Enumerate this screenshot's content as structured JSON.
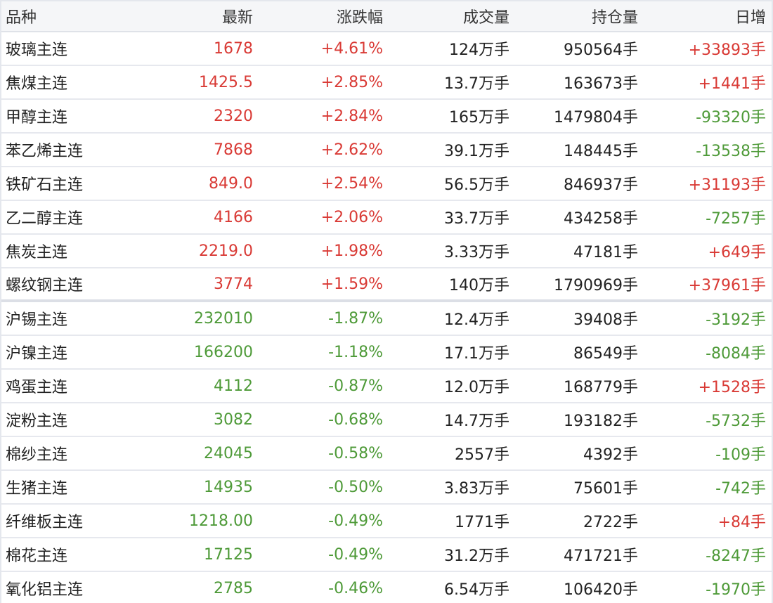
{
  "columns": {
    "name": "品种",
    "price": "最新",
    "change": "涨跌幅",
    "volume": "成交量",
    "open_interest": "持仓量",
    "daily_change": "日增"
  },
  "colors": {
    "up": "#d93a35",
    "down": "#4e9a38"
  },
  "rows": [
    {
      "name": "玻璃主连",
      "price": "1678",
      "change": "+4.61%",
      "volume": "124万手",
      "open_interest": "950564手",
      "daily_change": "+33893手",
      "trend": "up",
      "daily_trend": "up"
    },
    {
      "name": "焦煤主连",
      "price": "1425.5",
      "change": "+2.85%",
      "volume": "13.7万手",
      "open_interest": "163673手",
      "daily_change": "+1441手",
      "trend": "up",
      "daily_trend": "up"
    },
    {
      "name": "甲醇主连",
      "price": "2320",
      "change": "+2.84%",
      "volume": "165万手",
      "open_interest": "1479804手",
      "daily_change": "-93320手",
      "trend": "up",
      "daily_trend": "down"
    },
    {
      "name": "苯乙烯主连",
      "price": "7868",
      "change": "+2.62%",
      "volume": "39.1万手",
      "open_interest": "148445手",
      "daily_change": "-13538手",
      "trend": "up",
      "daily_trend": "down"
    },
    {
      "name": "铁矿石主连",
      "price": "849.0",
      "change": "+2.54%",
      "volume": "56.5万手",
      "open_interest": "846937手",
      "daily_change": "+31193手",
      "trend": "up",
      "daily_trend": "up"
    },
    {
      "name": "乙二醇主连",
      "price": "4166",
      "change": "+2.06%",
      "volume": "33.7万手",
      "open_interest": "434258手",
      "daily_change": "-7257手",
      "trend": "up",
      "daily_trend": "down"
    },
    {
      "name": "焦炭主连",
      "price": "2219.0",
      "change": "+1.98%",
      "volume": "3.33万手",
      "open_interest": "47181手",
      "daily_change": "+649手",
      "trend": "up",
      "daily_trend": "up"
    },
    {
      "name": "螺纹钢主连",
      "price": "3774",
      "change": "+1.59%",
      "volume": "140万手",
      "open_interest": "1790969手",
      "daily_change": "+37961手",
      "trend": "up",
      "daily_trend": "up"
    },
    {
      "name": "沪锡主连",
      "price": "232010",
      "change": "-1.87%",
      "volume": "12.4万手",
      "open_interest": "39408手",
      "daily_change": "-3192手",
      "trend": "down",
      "daily_trend": "down"
    },
    {
      "name": "沪镍主连",
      "price": "166200",
      "change": "-1.18%",
      "volume": "17.1万手",
      "open_interest": "86549手",
      "daily_change": "-8084手",
      "trend": "down",
      "daily_trend": "down"
    },
    {
      "name": "鸡蛋主连",
      "price": "4112",
      "change": "-0.87%",
      "volume": "12.0万手",
      "open_interest": "168779手",
      "daily_change": "+1528手",
      "trend": "down",
      "daily_trend": "up"
    },
    {
      "name": "淀粉主连",
      "price": "3082",
      "change": "-0.68%",
      "volume": "14.7万手",
      "open_interest": "193182手",
      "daily_change": "-5732手",
      "trend": "down",
      "daily_trend": "down"
    },
    {
      "name": "棉纱主连",
      "price": "24045",
      "change": "-0.58%",
      "volume": "2557手",
      "open_interest": "4392手",
      "daily_change": "-109手",
      "trend": "down",
      "daily_trend": "down"
    },
    {
      "name": "生猪主连",
      "price": "14935",
      "change": "-0.50%",
      "volume": "3.83万手",
      "open_interest": "75601手",
      "daily_change": "-742手",
      "trend": "down",
      "daily_trend": "down"
    },
    {
      "name": "纤维板主连",
      "price": "1218.00",
      "change": "-0.49%",
      "volume": "1771手",
      "open_interest": "2722手",
      "daily_change": "+84手",
      "trend": "down",
      "daily_trend": "up"
    },
    {
      "name": "棉花主连",
      "price": "17125",
      "change": "-0.49%",
      "volume": "31.2万手",
      "open_interest": "471721手",
      "daily_change": "-8247手",
      "trend": "down",
      "daily_trend": "down"
    },
    {
      "name": "氧化铝主连",
      "price": "2785",
      "change": "-0.46%",
      "volume": "6.54万手",
      "open_interest": "106420手",
      "daily_change": "-1970手",
      "trend": "down",
      "daily_trend": "down"
    }
  ]
}
